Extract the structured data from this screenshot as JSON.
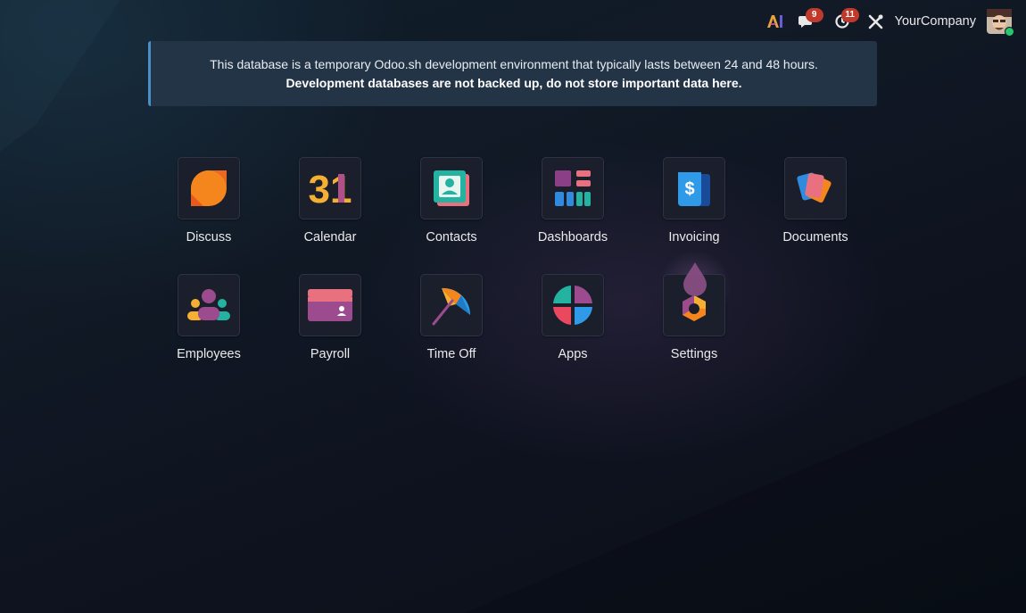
{
  "topbar": {
    "ai_icon": "ai-icon",
    "chat_icon": "chat-icon",
    "chat_count": "9",
    "activity_icon": "clock-icon",
    "activity_count": "11",
    "debug_icon": "wrench-screwdriver-icon",
    "company": "YourCompany",
    "avatar_icon": "avatar"
  },
  "banner": {
    "line1": "This database is a temporary Odoo.sh development environment that typically lasts between 24 and 48 hours.",
    "line2": "Development databases are not backed up, do not store important data here."
  },
  "apps": [
    {
      "label": "Discuss",
      "icon": "discuss-icon"
    },
    {
      "label": "Calendar",
      "icon": "calendar-icon",
      "icon_text": "31"
    },
    {
      "label": "Contacts",
      "icon": "contacts-icon"
    },
    {
      "label": "Dashboards",
      "icon": "dashboards-icon"
    },
    {
      "label": "Invoicing",
      "icon": "invoicing-icon",
      "icon_text": "$"
    },
    {
      "label": "Documents",
      "icon": "documents-icon"
    },
    {
      "label": "Employees",
      "icon": "employees-icon"
    },
    {
      "label": "Payroll",
      "icon": "payroll-icon"
    },
    {
      "label": "Time Off",
      "icon": "time-off-icon"
    },
    {
      "label": "Apps",
      "icon": "apps-icon"
    },
    {
      "label": "Settings",
      "icon": "settings-icon"
    }
  ],
  "colors": {
    "banner_bg": "#233446",
    "banner_accent": "#4a8fc6",
    "badge": "#c0392b",
    "presence": "#28c76f",
    "tile_bg": "#1b1f2b"
  }
}
